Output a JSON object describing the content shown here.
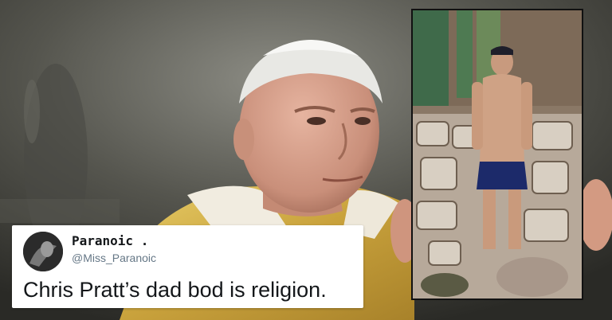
{
  "tweet": {
    "display_name": "Paranoic .",
    "handle": "@Miss_Paranoic",
    "text": "Chris Pratt’s dad bod is religion."
  },
  "colors": {
    "card_background": "#ffffff",
    "name_text": "#14171a",
    "handle_text": "#657786",
    "vestment_gold": "#d4b24a"
  },
  "icons": {
    "avatar": "user-avatar-icon"
  }
}
